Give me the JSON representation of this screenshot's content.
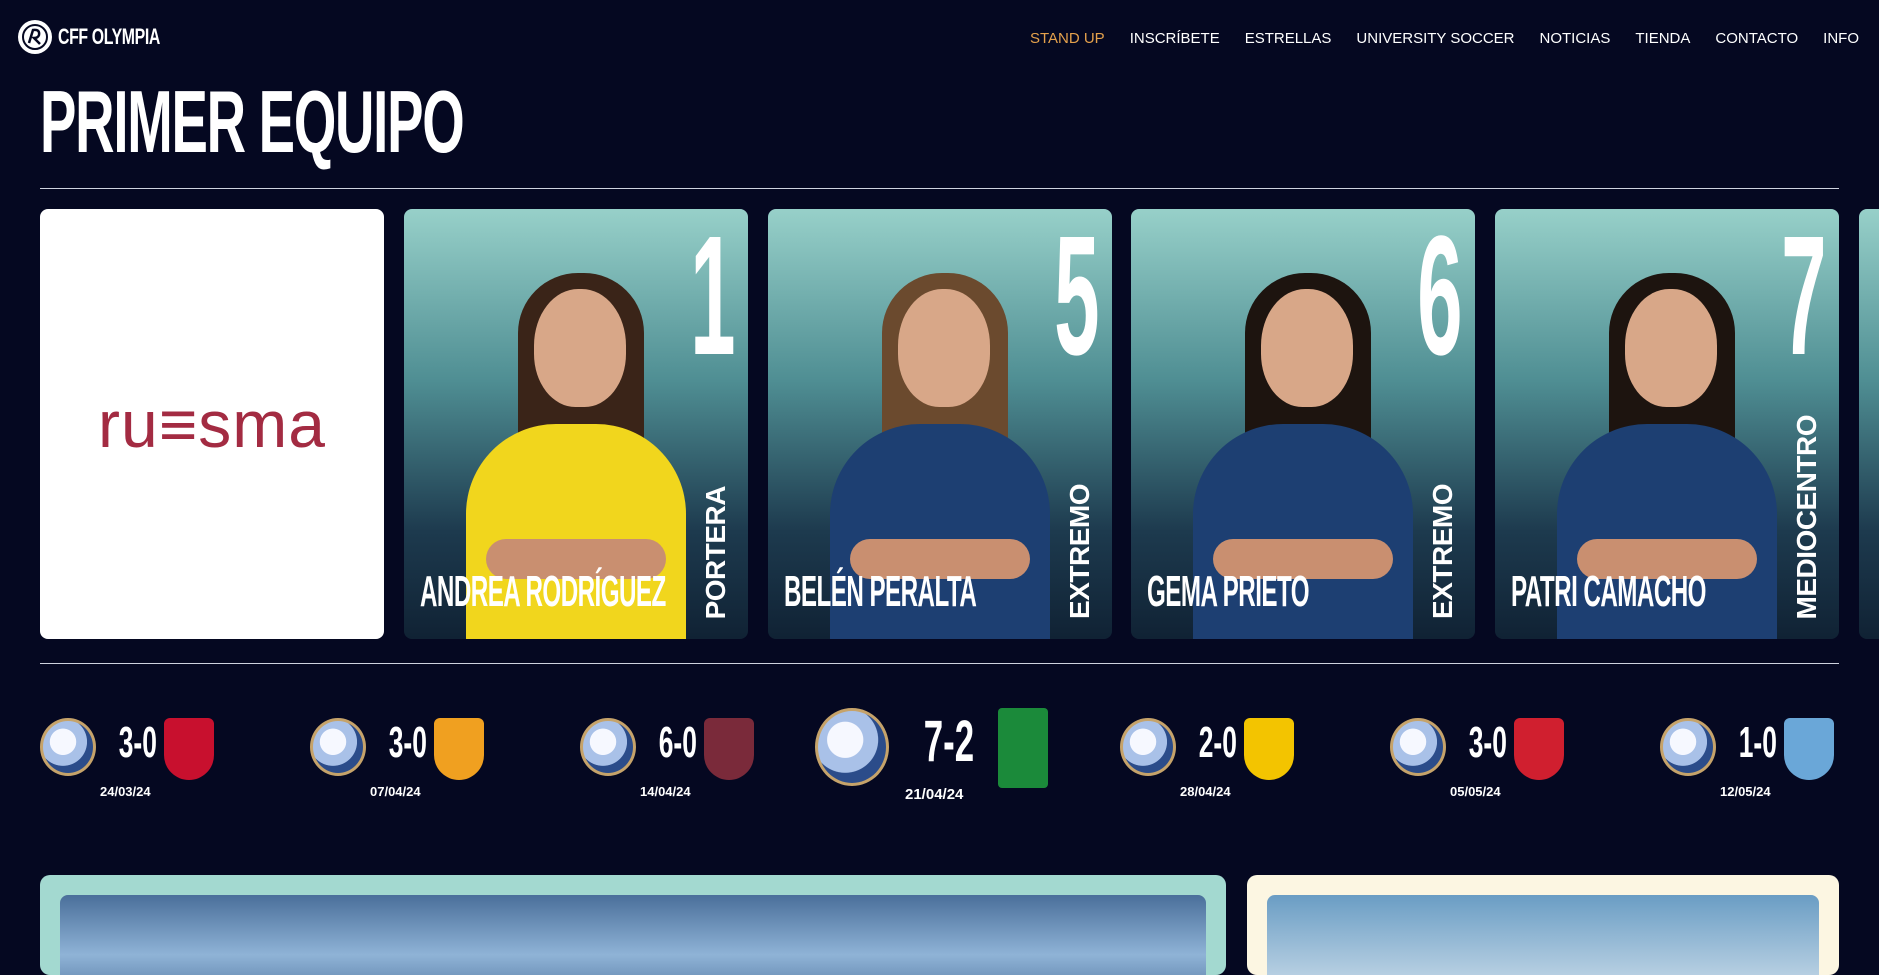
{
  "nav": {
    "brand": "CFF OLYMPIA",
    "items": [
      {
        "label": "STAND UP",
        "active": true
      },
      {
        "label": "INSCRÍBETE",
        "active": false
      },
      {
        "label": "ESTRELLAS",
        "active": false
      },
      {
        "label": "UNIVERSITY SOCCER",
        "active": false
      },
      {
        "label": "NOTICIAS",
        "active": false
      },
      {
        "label": "TIENDA",
        "active": false
      },
      {
        "label": "CONTACTO",
        "active": false
      },
      {
        "label": "INFO",
        "active": false
      }
    ]
  },
  "page": {
    "title": "PRIMER EQUIPO"
  },
  "sponsor": {
    "name": "ru≡sma"
  },
  "players": [
    {
      "number": "1",
      "name": "ANDREA RODRÍGUEZ",
      "position": "PORTERA",
      "kit": "yellow"
    },
    {
      "number": "5",
      "name": "BELÉN PERALTA",
      "position": "EXTREMO",
      "kit": "navy"
    },
    {
      "number": "6",
      "name": "GEMA PRIETO",
      "position": "EXTREMO",
      "kit": "navy"
    },
    {
      "number": "7",
      "name": "PATRI CAMACHO",
      "position": "MEDIOCENTRO",
      "kit": "navy"
    }
  ],
  "results": [
    {
      "score": "3-0",
      "date": "24/03/24",
      "opponent_color": "#c8102e",
      "featured": false
    },
    {
      "score": "3-0",
      "date": "07/04/24",
      "opponent_color": "#f0a020",
      "featured": false
    },
    {
      "score": "6-0",
      "date": "14/04/24",
      "opponent_color": "#7a2a3a",
      "featured": false
    },
    {
      "score": "7-2",
      "date": "21/04/24",
      "opponent_color": "#1b8a3a",
      "featured": true
    },
    {
      "score": "2-0",
      "date": "28/04/24",
      "opponent_color": "#f3c400",
      "featured": false
    },
    {
      "score": "3-0",
      "date": "05/05/24",
      "opponent_color": "#d01f2f",
      "featured": false
    },
    {
      "score": "1-0",
      "date": "12/05/24",
      "opponent_color": "#6aa7d8",
      "featured": false
    }
  ],
  "colors": {
    "background": "#050821",
    "accent": "#e5a14c",
    "sponsor_red": "#a32b42",
    "panel_mint": "#a3d9d0",
    "panel_cream": "#fcf6e2"
  }
}
